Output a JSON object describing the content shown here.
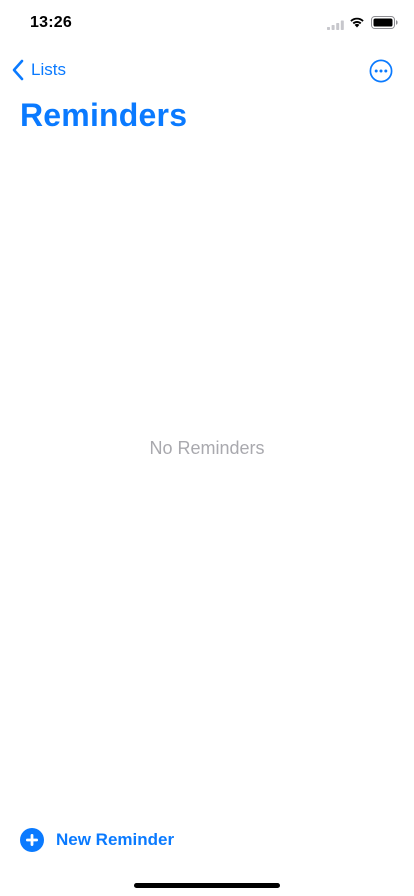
{
  "status_bar": {
    "time": "13:26",
    "icons": [
      "signal-icon",
      "wifi-icon",
      "battery-icon"
    ]
  },
  "nav": {
    "back_label": "Lists",
    "back_icon": "chevron-left-icon",
    "more_icon": "ellipsis-circle-icon"
  },
  "page": {
    "title": "Reminders",
    "empty_message": "No Reminders"
  },
  "toolbar": {
    "new_reminder_label": "New Reminder",
    "new_reminder_icon": "plus-circle-icon"
  },
  "colors": {
    "accent": "#0a7aff",
    "empty_text": "#a9a9ae",
    "background": "#ffffff"
  }
}
